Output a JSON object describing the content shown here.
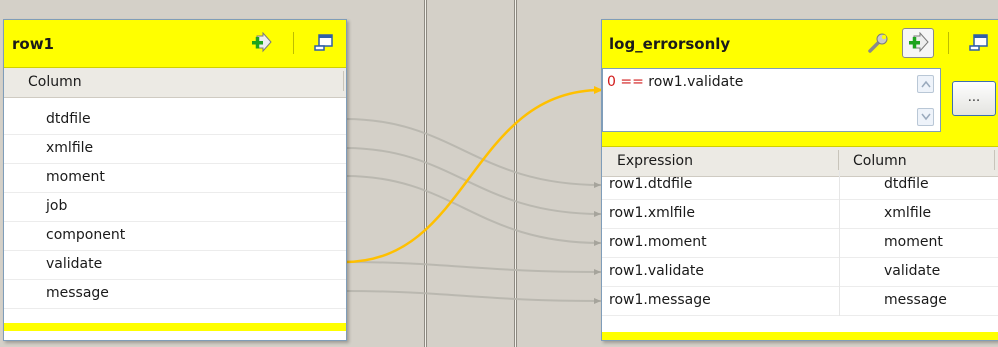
{
  "input_table": {
    "title": "row1",
    "column_header": "Column",
    "rows": [
      {
        "label": "dtdfile"
      },
      {
        "label": "xmlfile"
      },
      {
        "label": "moment"
      },
      {
        "label": "job"
      },
      {
        "label": "component"
      },
      {
        "label": "validate"
      },
      {
        "label": "message"
      }
    ]
  },
  "output_table": {
    "title": "log_errorsonly",
    "filter": {
      "value": "0",
      "operator": "==",
      "field": "row1.validate"
    },
    "more_button": "...",
    "headers": {
      "expression": "Expression",
      "column": "Column"
    },
    "rows": [
      {
        "expression": "row1.dtdfile",
        "column": "dtdfile"
      },
      {
        "expression": "row1.xmlfile",
        "column": "xmlfile"
      },
      {
        "expression": "row1.moment",
        "column": "moment"
      },
      {
        "expression": "row1.validate",
        "column": "validate"
      },
      {
        "expression": "row1.message",
        "column": "message"
      }
    ]
  },
  "colors": {
    "header_yellow": "#ffff00",
    "link_highlight": "#ffc000",
    "link_normal": "#b8b6ae",
    "operator_red": "#d11a1a",
    "background": "#d4d0c8"
  },
  "icons": [
    "add-output-icon",
    "minimize-icon",
    "wrench-icon"
  ]
}
